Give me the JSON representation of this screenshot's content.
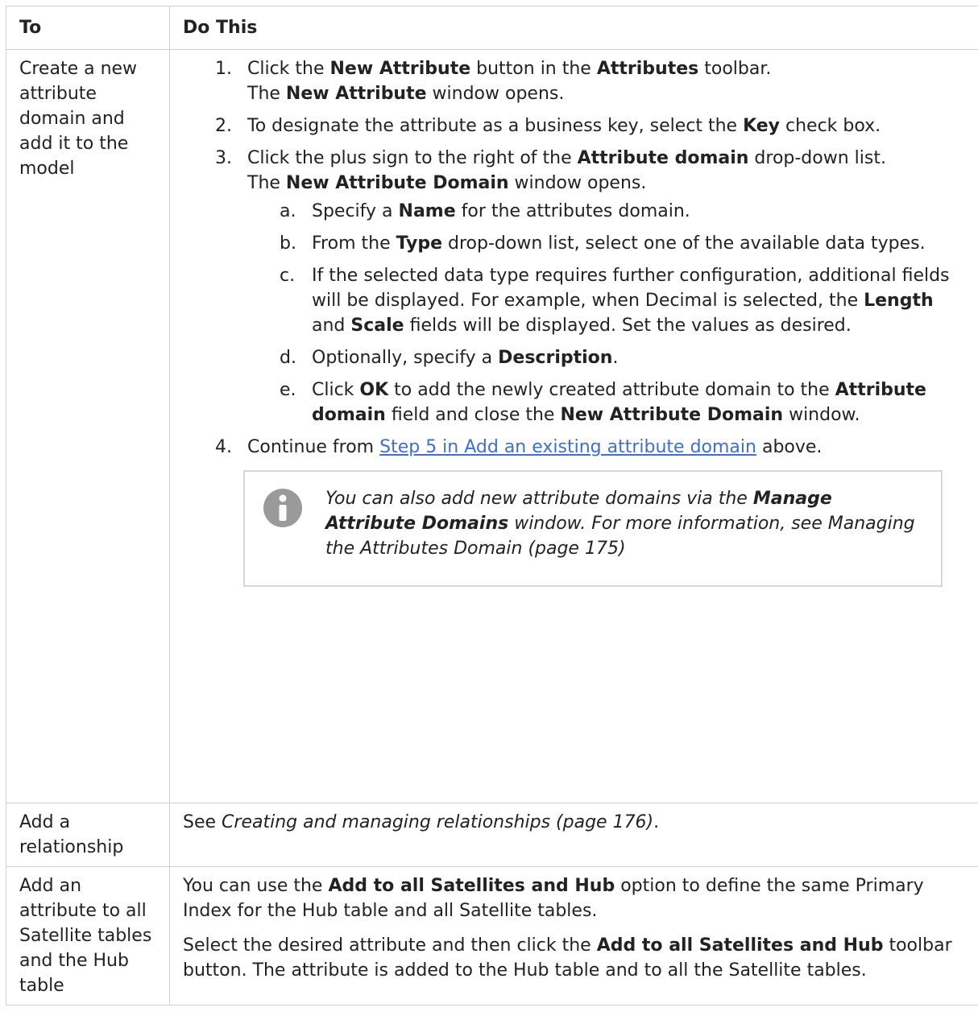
{
  "header": {
    "col1": "To",
    "col2": "Do This"
  },
  "row1": {
    "to": "Create a new attribute domain and add it to the model",
    "step1": {
      "num": "1.",
      "t1": "Click the ",
      "b1": "New Attribute",
      "t2": " button in the ",
      "b2": "Attributes",
      "t3": " toolbar.",
      "t4": "The ",
      "b3": "New Attribute",
      "t5": " window opens."
    },
    "step2": {
      "num": "2.",
      "t1": "To designate the attribute as a business key, select the ",
      "b1": "Key",
      "t2": " check box."
    },
    "step3": {
      "num": "3.",
      "t1": "Click the plus sign to the right of the ",
      "b1": "Attribute domain",
      "t2": " drop-down list.",
      "t3": "The ",
      "b2": "New Attribute Domain",
      "t4": " window opens.",
      "a": {
        "num": "a.",
        "t1": "Specify a ",
        "b1": "Name",
        "t2": " for the attributes domain."
      },
      "b": {
        "num": "b.",
        "t1": "From the ",
        "b1": "Type",
        "t2": " drop-down list, select one of the available data types."
      },
      "c": {
        "num": "c.",
        "t1": "If the selected data type requires further configuration, additional fields will be displayed. For example, when Decimal is selected, the ",
        "b1": "Length",
        "t2": " and ",
        "b2": "Scale",
        "t3": " fields will be displayed. Set the values as desired."
      },
      "d": {
        "num": "d.",
        "t1": "Optionally, specify a ",
        "b1": "Description",
        "t2": "."
      },
      "e": {
        "num": "e.",
        "t1": "Click ",
        "b1": "OK",
        "t2": " to add the newly created attribute domain to the ",
        "b2": "Attribute domain",
        "t3": " field and close the ",
        "b3": "New Attribute Domain",
        "t4": " window."
      }
    },
    "step4": {
      "num": "4.",
      "t1": "Continue from ",
      "link": "Step 5 in Add an existing attribute domain",
      "t2": " above."
    },
    "note": {
      "t1": "You can also add new attribute domains via the ",
      "b1": "Manage Attribute Domains",
      "t2": " window. For more information, see Managing the Attributes Domain (page 175)"
    }
  },
  "row2": {
    "to": "Add a relationship",
    "t1": "See ",
    "i1": "Creating and managing relationships (page 176)",
    "t2": "."
  },
  "row3": {
    "to": "Add an attribute to all Satellite tables and the Hub table",
    "p1": {
      "t1": "You can use the ",
      "b1": "Add to all Satellites and Hub",
      "t2": " option to define the same Primary Index for the Hub table and all Satellite tables."
    },
    "p2": {
      "t1": "Select the desired attribute and then click the ",
      "b1": "Add to all Satellites and Hub",
      "t2": " toolbar button. The attribute is added to the Hub table and to all the Satellite tables."
    }
  },
  "colors": {
    "border": "#cfcfcf",
    "link": "#3c6fd1",
    "note_border": "#d6d6d6",
    "icon": "#9a9a9a"
  }
}
